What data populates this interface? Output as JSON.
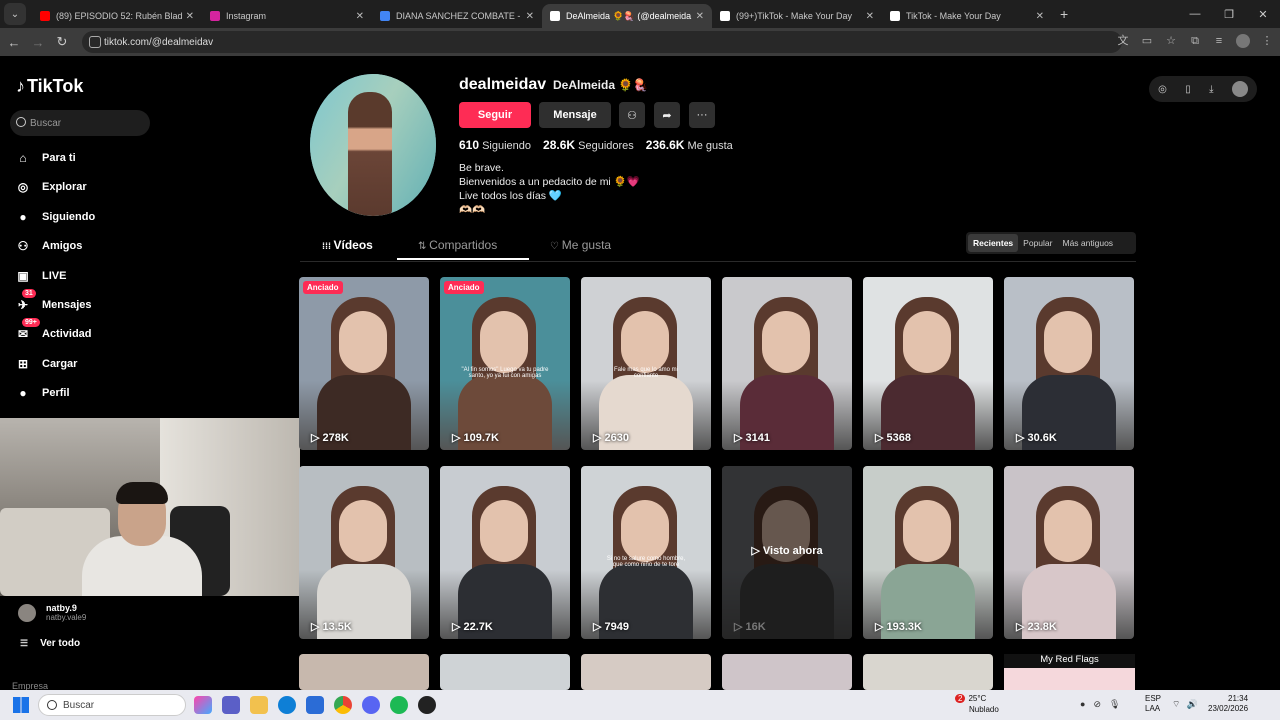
{
  "browser": {
    "tabs": [
      {
        "title": "(89) EPISODIO 52: Rubén Blade",
        "color": "#ff0000"
      },
      {
        "title": "Instagram",
        "color": "#d6249f"
      },
      {
        "title": "DIANA SANCHEZ COMBATE - B",
        "color": "#4285f4"
      },
      {
        "title": "DeAlmeida 🌻🪼 (@dealmeida",
        "color": "#000000"
      },
      {
        "title": "(99+)TikTok - Make Your Day",
        "color": "#000000"
      },
      {
        "title": "TikTok - Make Your Day",
        "color": "#000000"
      }
    ],
    "new_tab": "+",
    "url": "tiktok.com/@dealmeidav"
  },
  "sidebar": {
    "logo": "TikTok",
    "search_placeholder": "Buscar",
    "items": [
      {
        "label": "Para ti",
        "icon": "home-icon"
      },
      {
        "label": "Explorar",
        "icon": "compass-icon"
      },
      {
        "label": "Siguiendo",
        "icon": "following-icon"
      },
      {
        "label": "Amigos",
        "icon": "friends-icon"
      },
      {
        "label": "LIVE",
        "icon": "live-icon"
      },
      {
        "label": "Mensajes",
        "icon": "messages-icon",
        "badge": "31"
      },
      {
        "label": "Actividad",
        "icon": "activity-icon",
        "badge": "99+"
      },
      {
        "label": "Cargar",
        "icon": "upload-icon"
      },
      {
        "label": "Perfil",
        "icon": "profile-icon"
      }
    ],
    "following_user": {
      "name": "natby.9",
      "handle": "natby.vale9"
    },
    "see_all": "Ver todo",
    "footer": "Empresa"
  },
  "profile": {
    "username": "dealmeidav",
    "display_name": "DeAlmeida 🌻🪼",
    "follow_label": "Seguir",
    "message_label": "Mensaje",
    "stats": [
      {
        "value": "610",
        "label": "Siguiendo"
      },
      {
        "value": "28.6K",
        "label": "Seguidores"
      },
      {
        "value": "236.6K",
        "label": "Me gusta"
      }
    ],
    "bio": [
      "Be brave.",
      "Bienvenidos a un pedacito de mi 🌻💗",
      "Live todos los días 🩵",
      "🫶🏻🫶🏻"
    ]
  },
  "tabs": {
    "videos": "Vídeos",
    "shared": "Compartidos",
    "liked": "Me gusta"
  },
  "sort": {
    "recent": "Recientes",
    "popular": "Popular",
    "oldest": "Más antiguos"
  },
  "videos": [
    {
      "views": "278K",
      "pinned": "Anciado",
      "bg": "#8e9aa8",
      "shirt": "#3d2a24"
    },
    {
      "views": "109.7K",
      "pinned": "Anciado",
      "bg": "#4b8f9a",
      "shirt": "#6d4a3a",
      "overlay": "\"Al fin somos\" Luego va tu padre santo, yo ya fui con amigas"
    },
    {
      "views": "2630",
      "bg": "#cfd1d4",
      "shirt": "#e5d9cf",
      "overlay": "Fale mas que lo amo mi confiante"
    },
    {
      "views": "3141",
      "bg": "#c9c9cc",
      "shirt": "#5a2c38"
    },
    {
      "views": "5368",
      "bg": "#dfe2e3",
      "shirt": "#4b2a30"
    },
    {
      "views": "30.6K",
      "bg": "#b9bfc7",
      "shirt": "#2c2e35"
    },
    {
      "views": "13.5K",
      "bg": "#b8bec2",
      "shirt": "#d9d7d3"
    },
    {
      "views": "22.7K",
      "bg": "#c8ccd1",
      "shirt": "#2c2e33"
    },
    {
      "views": "7949",
      "bg": "#cfd3d6",
      "shirt": "#2d2f33",
      "overlay": "Si no te salure como hombre, que como niño de te tore"
    },
    {
      "views": "16K",
      "bg": "#6f7277",
      "shirt": "#444",
      "watched": "Visto ahora"
    },
    {
      "views": "193.3K",
      "bg": "#c7cdc9",
      "shirt": "#8aa595"
    },
    {
      "views": "23.8K",
      "bg": "#c9c3c8",
      "shirt": "#d8c7c9"
    }
  ],
  "partial_row_label": "My Red Flags",
  "taskbar": {
    "search": "Buscar",
    "weather_temp": "25°C",
    "weather_desc": "Nublado",
    "weather_badge": "2",
    "lang1": "ESP",
    "lang2": "LAA",
    "time": "21:34",
    "date": "23/02/2026"
  }
}
